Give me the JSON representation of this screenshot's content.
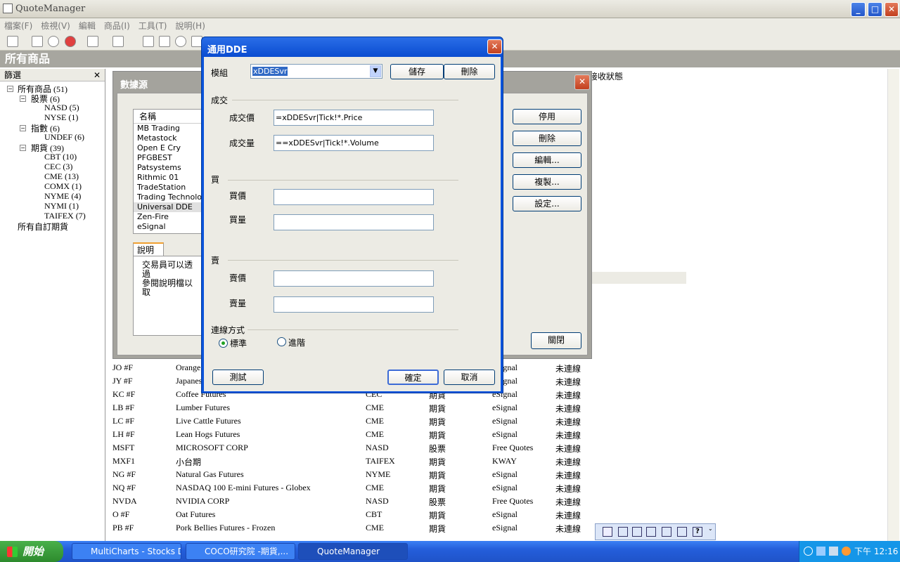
{
  "window": {
    "title": "QuoteManager"
  },
  "menu": [
    "檔案(F)",
    "檢視(V)",
    "編輯",
    "商品(I)",
    "工具(T)",
    "說明(H)"
  ],
  "section_title": "所有商品",
  "tree": {
    "header": "篩選",
    "nodes": [
      {
        "label": "所有商品  (51)"
      },
      {
        "label": "股票  (6)"
      },
      {
        "label": "NASD  (5)"
      },
      {
        "label": "NYSE  (1)"
      },
      {
        "label": "指數  (6)"
      },
      {
        "label": "UNDEF  (6)"
      },
      {
        "label": "期貨  (39)"
      },
      {
        "label": "CBT  (10)"
      },
      {
        "label": "CEC  (3)"
      },
      {
        "label": "CME  (13)"
      },
      {
        "label": "COMX  (1)"
      },
      {
        "label": "NYME  (4)"
      },
      {
        "label": "NYMI  (1)"
      },
      {
        "label": "TAIFEX  (7)"
      },
      {
        "label": "所有自訂期貨"
      }
    ]
  },
  "list": {
    "col_status_header": "接收狀態",
    "rows": [
      {
        "sym": "JO #F",
        "name": "Orange",
        "exch": "",
        "type": "",
        "src": "eSignal",
        "status": "未連線"
      },
      {
        "sym": "JY #F",
        "name": "Japanese",
        "exch": "",
        "type": "",
        "src": "eSignal",
        "status": "未連線"
      },
      {
        "sym": "KC #F",
        "name": "Coffee Futures",
        "exch": "CEC",
        "type": "期貨",
        "src": "eSignal",
        "status": "未連線"
      },
      {
        "sym": "LB #F",
        "name": "Lumber Futures",
        "exch": "CME",
        "type": "期貨",
        "src": "eSignal",
        "status": "未連線"
      },
      {
        "sym": "LC #F",
        "name": "Live Cattle Futures",
        "exch": "CME",
        "type": "期貨",
        "src": "eSignal",
        "status": "未連線"
      },
      {
        "sym": "LH #F",
        "name": "Lean Hogs Futures",
        "exch": "CME",
        "type": "期貨",
        "src": "eSignal",
        "status": "未連線"
      },
      {
        "sym": "MSFT",
        "name": "MICROSOFT CORP",
        "exch": "NASD",
        "type": "股票",
        "src": "Free Quotes",
        "status": "未連線"
      },
      {
        "sym": "MXF1",
        "name": "小台期",
        "exch": "TAIFEX",
        "type": "期貨",
        "src": "KWAY",
        "status": "未連線"
      },
      {
        "sym": "NG #F",
        "name": "Natural Gas Futures",
        "exch": "NYME",
        "type": "期貨",
        "src": "eSignal",
        "status": "未連線"
      },
      {
        "sym": "NQ #F",
        "name": "NASDAQ 100 E-mini Futures - Globex",
        "exch": "CME",
        "type": "期貨",
        "src": "eSignal",
        "status": "未連線"
      },
      {
        "sym": "NVDA",
        "name": "NVIDIA CORP",
        "exch": "NASD",
        "type": "股票",
        "src": "Free Quotes",
        "status": "未連線"
      },
      {
        "sym": "O #F",
        "name": "Oat Futures",
        "exch": "CBT",
        "type": "期貨",
        "src": "eSignal",
        "status": "未連線"
      },
      {
        "sym": "PB #F",
        "name": "Pork Bellies Futures - Frozen",
        "exch": "CME",
        "type": "期貨",
        "src": "eSignal",
        "status": "未連線"
      }
    ]
  },
  "datasource_dialog": {
    "title": "數據源",
    "list_header": "名稱",
    "items": [
      "MB Trading",
      "Metastock",
      "Open E Cry",
      "PFGBEST",
      "Patsystems",
      "Rithmic 01",
      "TradeStation",
      "Trading Technologi",
      "Universal DDE",
      "Zen-Fire",
      "eSignal"
    ],
    "selected_index": 8,
    "tab_label": "說明",
    "desc_line1": "交易員可以透過",
    "desc_line2": "參閱說明檔以取",
    "buttons": {
      "disable": "停用",
      "delete": "刪除",
      "edit": "編輯...",
      "copy": "複製...",
      "settings": "設定...",
      "close": "關閉"
    }
  },
  "dde_dialog": {
    "title": "通用DDE",
    "template_label": "模組",
    "template_value": "xDDESvr",
    "save": "儲存",
    "delete": "刪除",
    "trade_group": "成交",
    "price_label": "成交價",
    "price_value": "=xDDESvr|Tick!*.Price",
    "volume_label": "成交量",
    "volume_value": "==xDDESvr|Tick!*.Volume",
    "bid_group": "買",
    "bid_price_label": "買價",
    "bid_price_value": "",
    "bid_size_label": "買量",
    "bid_size_value": "",
    "ask_group": "賣",
    "ask_price_label": "賣價",
    "ask_price_value": "",
    "ask_size_label": "賣量",
    "ask_size_value": "",
    "conn_group": "連線方式",
    "radio_standard": "標準",
    "radio_advanced": "進階",
    "test": "測試",
    "ok": "確定",
    "cancel": "取消"
  },
  "taskbar": {
    "start": "開始",
    "tasks": [
      "MultiCharts - Stocks D...",
      "COCO研究院 -期貨,...",
      "QuoteManager"
    ],
    "clock": "下午 12:16"
  }
}
